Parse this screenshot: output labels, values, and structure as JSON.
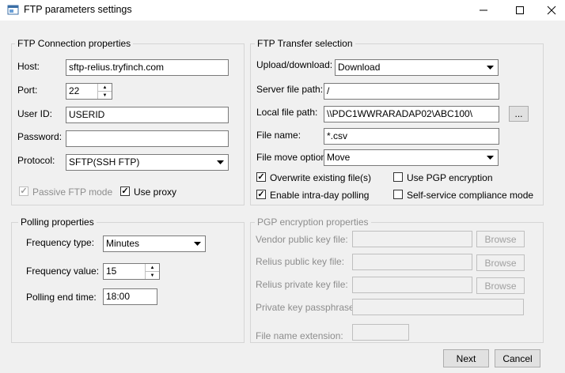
{
  "window": {
    "title": "FTP parameters settings"
  },
  "connection": {
    "group_title": "FTP Connection properties",
    "host_label": "Host:",
    "host_value": "sftp-relius.tryfinch.com",
    "port_label": "Port:",
    "port_value": "22",
    "user_label": "User ID:",
    "user_value": "USERID",
    "password_label": "Password:",
    "password_value": "",
    "protocol_label": "Protocol:",
    "protocol_value": "SFTP(SSH FTP)",
    "passive_label": "Passive FTP mode",
    "passive_checked": true,
    "proxy_label": "Use proxy",
    "proxy_checked": true
  },
  "transfer": {
    "group_title": "FTP Transfer selection",
    "updown_label": "Upload/download:",
    "updown_value": "Download",
    "server_path_label": "Server file path:",
    "server_path_value": "/",
    "local_path_label": "Local file path:",
    "local_path_value": "\\\\PDC1WWRARADAP02\\ABC100\\",
    "browse_label": "...",
    "file_name_label": "File name:",
    "file_name_value": "*.csv",
    "move_label": "File move option:",
    "move_value": "Move",
    "overwrite_label": "Overwrite existing file(s)",
    "overwrite_checked": true,
    "pgp_label": "Use PGP encryption",
    "pgp_checked": false,
    "intraday_label": "Enable intra-day polling",
    "intraday_checked": true,
    "selfservice_label": "Self-service compliance mode",
    "selfservice_checked": false
  },
  "polling": {
    "group_title": "Polling properties",
    "freq_type_label": "Frequency type:",
    "freq_type_value": "Minutes",
    "freq_value_label": "Frequency value:",
    "freq_value_value": "15",
    "end_time_label": "Polling end time:",
    "end_time_value": "18:00"
  },
  "pgp": {
    "group_title": "PGP encryption properties",
    "vendor_label": "Vendor public key file:",
    "relius_public_label": "Relius public key file:",
    "relius_private_label": "Relius private key file:",
    "passphrase_label": "Private key passphrase:",
    "extension_label": "File name extension:",
    "browse_label": "Browse"
  },
  "buttons": {
    "next_label": "Next",
    "cancel_label": "Cancel"
  }
}
